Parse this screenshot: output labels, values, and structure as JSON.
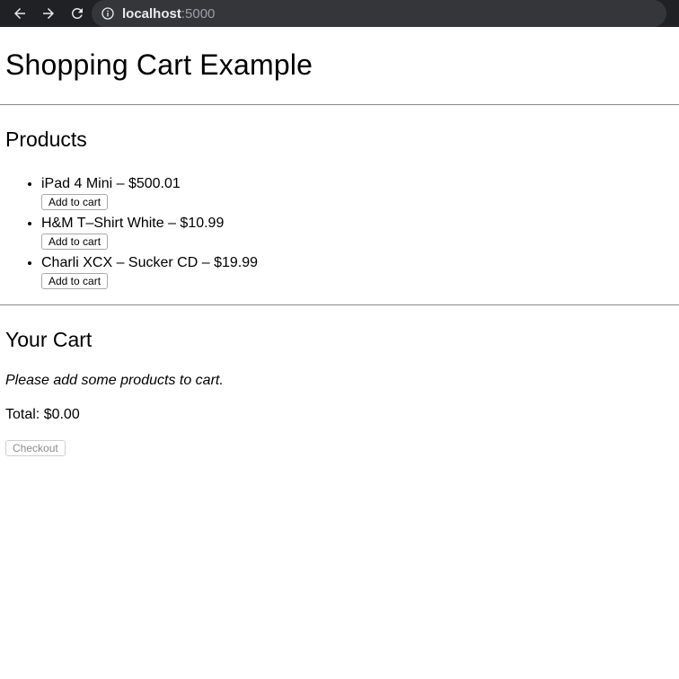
{
  "browser": {
    "url_host": "localhost",
    "url_port": ":5000",
    "icons": [
      "back-arrow-icon",
      "forward-arrow-icon",
      "reload-icon",
      "info-icon"
    ]
  },
  "page": {
    "title": "Shopping Cart Example",
    "products_heading": "Products",
    "products": [
      {
        "label": "iPad 4 Mini – $500.01",
        "button": "Add to cart"
      },
      {
        "label": "H&M T–Shirt White – $10.99",
        "button": "Add to cart"
      },
      {
        "label": "Charli XCX – Sucker CD – $19.99",
        "button": "Add to cart"
      }
    ],
    "cart_heading": "Your Cart",
    "empty_message": "Please add some products to cart.",
    "total_label": "Total: $0.00",
    "checkout_label": "Checkout"
  },
  "colors": {
    "toolbar_bg": "#202124",
    "omnibox_bg": "#35363a",
    "url_host": "#e8eaed",
    "url_port": "#9aa0a6",
    "disabled_text": "#8c8c8c"
  }
}
